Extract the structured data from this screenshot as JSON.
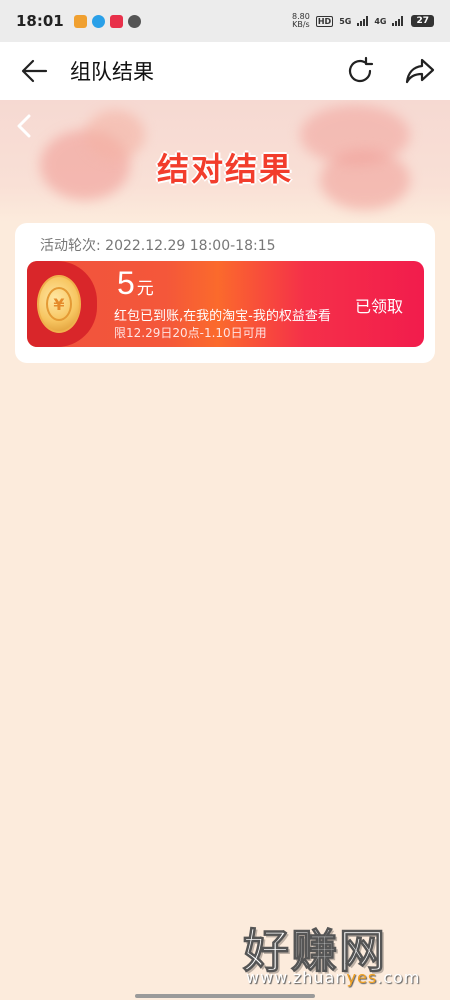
{
  "status_bar": {
    "time": "18:01",
    "net_speed_value": "8.80",
    "net_speed_unit": "KB/s",
    "hd_label": "HD",
    "signal1_label": "5G",
    "signal2_label": "4G",
    "battery": "27"
  },
  "nav": {
    "title": "组队结果",
    "back_icon": "arrow-left-icon",
    "refresh_icon": "refresh-icon",
    "share_icon": "share-icon"
  },
  "banner": {
    "title": "结对结果",
    "back_icon": "chevron-left-icon"
  },
  "result_card": {
    "round_label": "活动轮次: 2022.12.29 18:00-18:15",
    "coupon": {
      "amount": "5",
      "unit": "元",
      "description": "红包已到账,在我的淘宝-我的权益查看",
      "validity": "限12.29日20点-1.10日可用",
      "status": "已领取",
      "coin_symbol": "¥"
    }
  },
  "watermark": {
    "title": "好赚网",
    "url_prefix": "www.zhuan",
    "url_highlight": "yes",
    "url_suffix": ".com"
  },
  "colors": {
    "page_bg": "#fcebdc",
    "accent_red": "#f23d2c",
    "coupon_red": "#f21c4c",
    "coupon_orange": "#fb6a2c"
  }
}
